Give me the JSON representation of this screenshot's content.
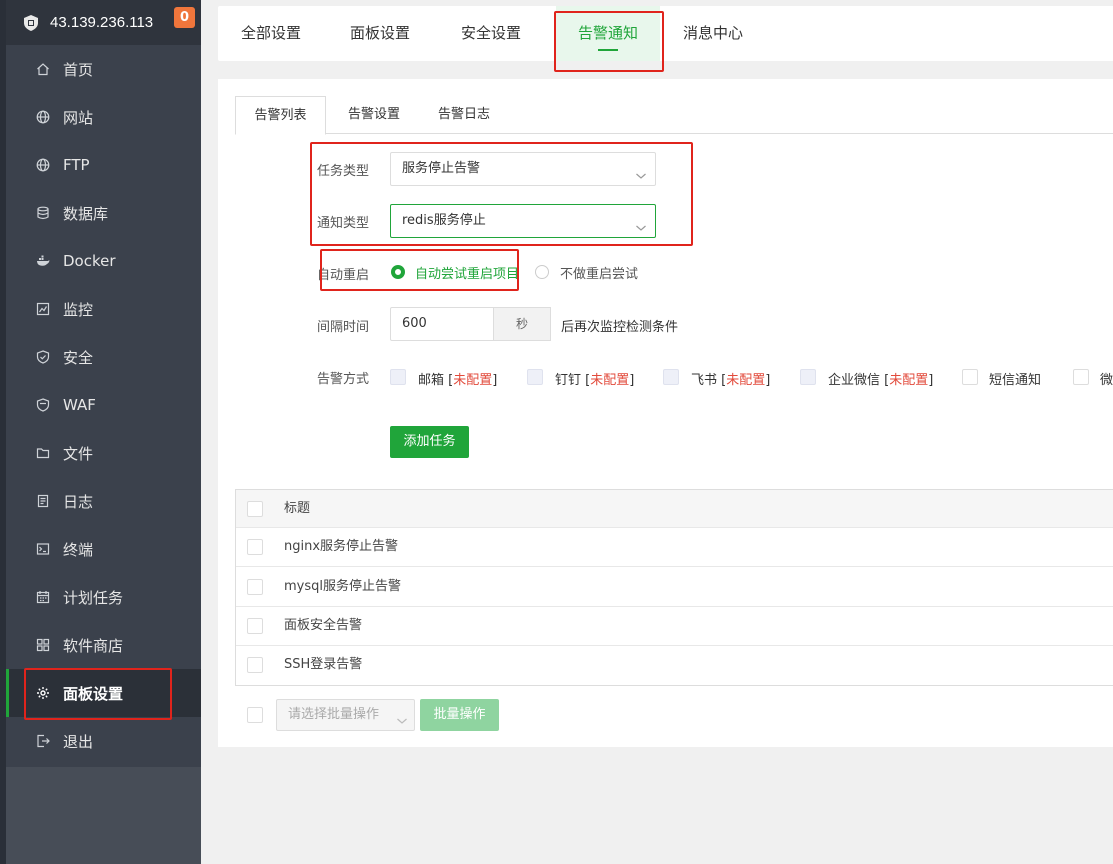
{
  "sidebar": {
    "server_ip": "43.139.236.113",
    "badge_count": "0",
    "items": [
      {
        "label": "首页",
        "icon": "home-icon"
      },
      {
        "label": "网站",
        "icon": "globe-icon"
      },
      {
        "label": "FTP",
        "icon": "globe-icon"
      },
      {
        "label": "数据库",
        "icon": "database-icon"
      },
      {
        "label": "Docker",
        "icon": "docker-icon"
      },
      {
        "label": "监控",
        "icon": "monitor-chart-icon"
      },
      {
        "label": "安全",
        "icon": "shield-check-icon"
      },
      {
        "label": "WAF",
        "icon": "shield-icon"
      },
      {
        "label": "文件",
        "icon": "folder-icon"
      },
      {
        "label": "日志",
        "icon": "document-icon"
      },
      {
        "label": "终端",
        "icon": "terminal-icon"
      },
      {
        "label": "计划任务",
        "icon": "calendar-icon"
      },
      {
        "label": "软件商店",
        "icon": "grid-icon"
      },
      {
        "label": "面板设置",
        "icon": "gear-icon",
        "active": true
      },
      {
        "label": "退出",
        "icon": "logout-icon"
      }
    ]
  },
  "top_tabs": [
    {
      "label": "全部设置"
    },
    {
      "label": "面板设置"
    },
    {
      "label": "安全设置"
    },
    {
      "label": "告警通知",
      "active": true
    },
    {
      "label": "消息中心"
    }
  ],
  "sub_tabs": [
    {
      "label": "告警列表",
      "active": true
    },
    {
      "label": "告警设置"
    },
    {
      "label": "告警日志"
    }
  ],
  "form": {
    "task_type_label": "任务类型",
    "task_type_value": "服务停止告警",
    "notify_type_label": "通知类型",
    "notify_type_value": "redis服务停止",
    "restart_label": "自动重启",
    "restart_option_on": "自动尝试重启项目",
    "restart_option_off": "不做重启尝试",
    "interval_label": "间隔时间",
    "interval_value": "600",
    "interval_unit": "秒",
    "interval_suffix": "后再次监控检测条件",
    "method_label": "告警方式",
    "methods": [
      {
        "name": "邮箱",
        "status": "未配置"
      },
      {
        "name": "钉钉",
        "status": "未配置"
      },
      {
        "name": "飞书",
        "status": "未配置"
      },
      {
        "name": "企业微信",
        "status": "未配置"
      },
      {
        "name": "短信通知",
        "status": ""
      },
      {
        "name": "微",
        "status": ""
      }
    ],
    "add_button": "添加任务"
  },
  "table": {
    "header_title": "标题",
    "rows": [
      {
        "title": "nginx服务停止告警"
      },
      {
        "title": "mysql服务停止告警"
      },
      {
        "title": "面板安全告警"
      },
      {
        "title": "SSH登录告警"
      }
    ]
  },
  "batch": {
    "select_placeholder": "请选择批量操作",
    "button": "批量操作"
  },
  "colors": {
    "accent": "#20a53a",
    "sidebar_bg": "#3b414c",
    "warning": "#e24a3b",
    "highlight_box": "#e0241c"
  }
}
